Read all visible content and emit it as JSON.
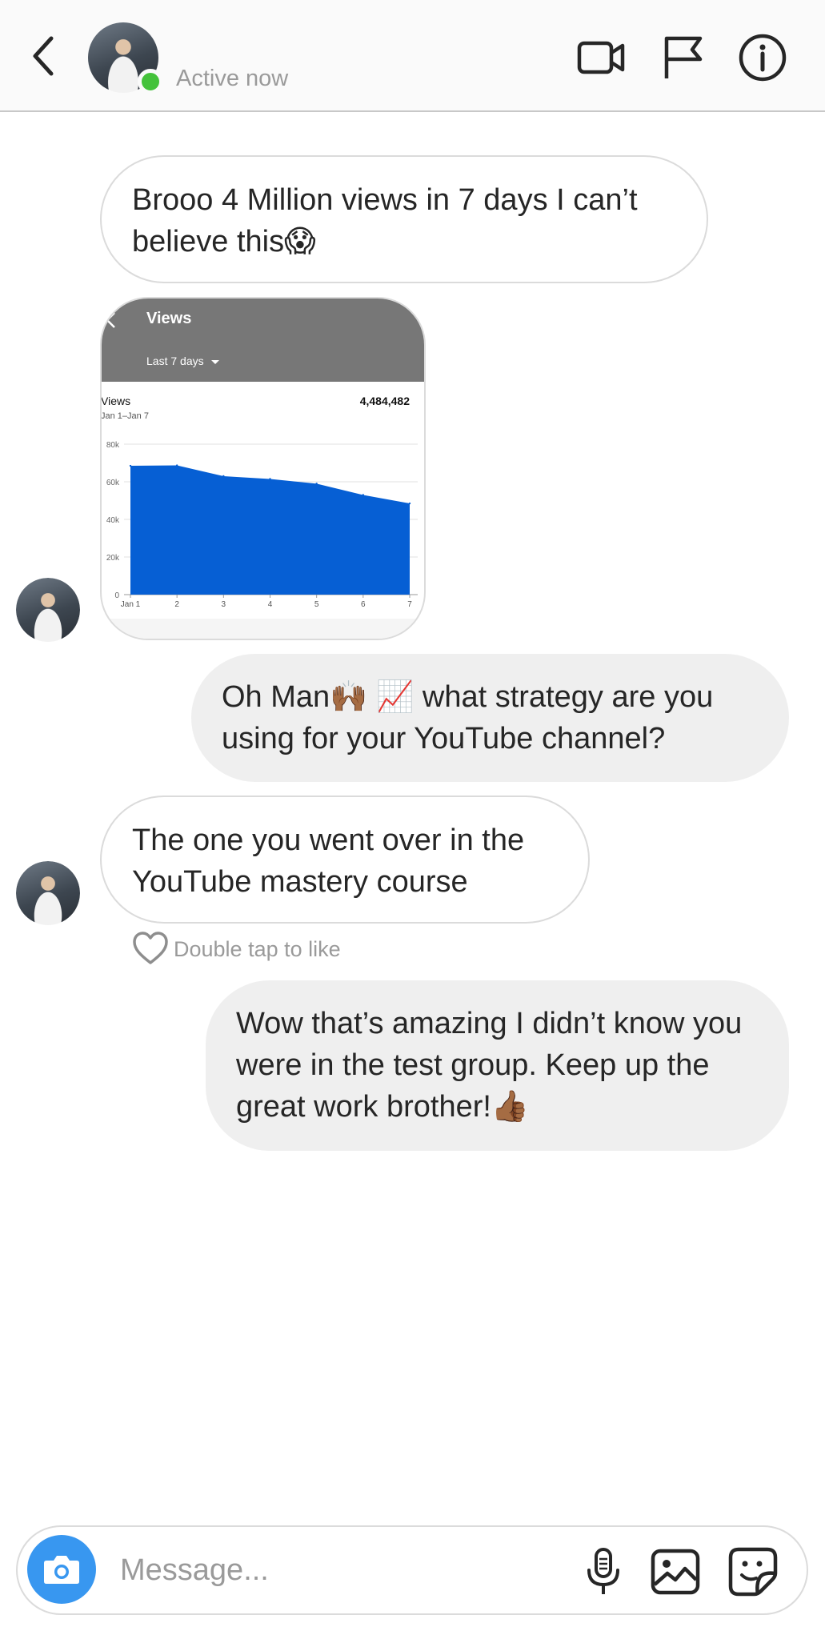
{
  "header": {
    "status": "Active now"
  },
  "messages": [
    {
      "type": "text",
      "direction": "received",
      "text": "Brooo 4 Million views in 7 days I can’t believe this😱"
    },
    {
      "type": "image",
      "direction": "received"
    },
    {
      "type": "text",
      "direction": "sent",
      "text": "Oh Man🙌🏾 📈  what strategy are you using for your YouTube channel?"
    },
    {
      "type": "text",
      "direction": "received",
      "text": "The one you went over in the YouTube mastery course"
    },
    {
      "type": "text",
      "direction": "sent",
      "text": "Wow that’s amazing I didn’t know you were in the test group. Keep up the great work brother!👍🏾"
    }
  ],
  "like_hint": "Double tap to like",
  "shared_image": {
    "title": "Views",
    "range": "Last 7 days",
    "metric_label": "Views",
    "total": "4,484,482",
    "date_range": "Jan 1–Jan 7",
    "chart_data": {
      "type": "area",
      "x": [
        "Jan 1",
        "2",
        "3",
        "4",
        "5",
        "6",
        "7"
      ],
      "values": [
        68500,
        68700,
        63000,
        61500,
        59000,
        53000,
        48500
      ],
      "y_ticks": [
        "0",
        "20k",
        "40k",
        "60k",
        "80k"
      ],
      "ylim": [
        0,
        80000
      ],
      "color": "#065fd4",
      "grid": true
    }
  },
  "composer": {
    "placeholder": "Message..."
  },
  "colors": {
    "online": "#44c23b",
    "camera_button": "#3897f0",
    "sent_bubble": "#efefef",
    "received_border": "#dbdbdb"
  },
  "icons": [
    "back-arrow-icon",
    "video-call-icon",
    "flag-icon",
    "info-icon",
    "heart-icon",
    "camera-icon",
    "microphone-icon",
    "gallery-icon",
    "sticker-icon"
  ]
}
